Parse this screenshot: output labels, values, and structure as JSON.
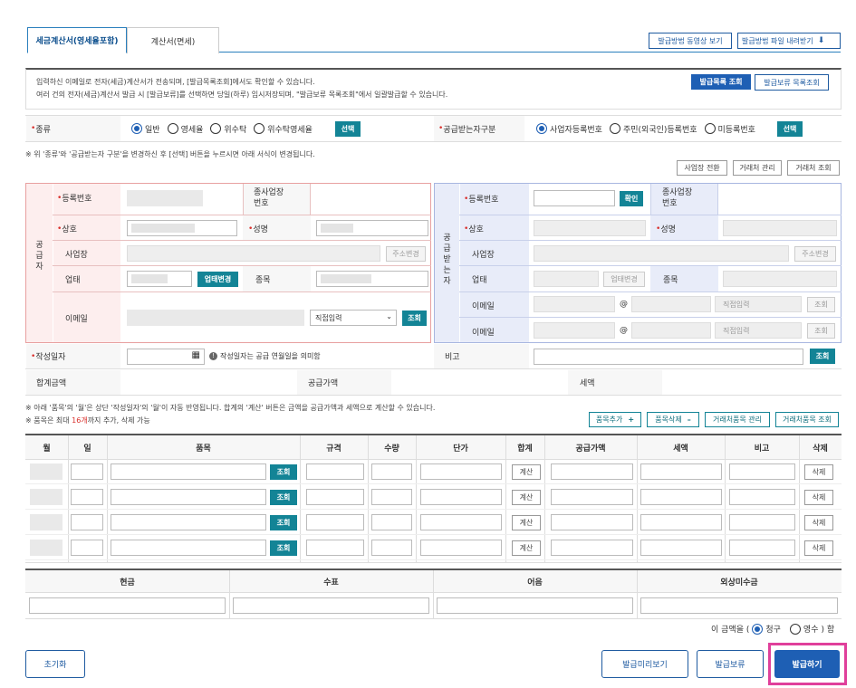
{
  "tabs": [
    {
      "label": "세금계산서(영세율포함)"
    },
    {
      "label": "계산서(면세)"
    }
  ],
  "top_buttons": {
    "video": "발급방법 동영상 보기",
    "file": "발급방법 파일 내려받기"
  },
  "notice": {
    "line1": "입력하신 이메일로 전자(세금)계산서가 전송되며, [발급목록조회]에서도 확인할 수 있습니다.",
    "line2": "여러 건의 전자(세금)계산서 발급 시 [발급보류]를 선택하면 당일(하루) 임시저장되며, \"발급보류 목록조회\"에서 일괄발급할 수 있습니다.",
    "btn_list": "발급목록 조회",
    "btn_hold": "발급보류 목록조회"
  },
  "type_row": {
    "label": "종류",
    "options": [
      "일반",
      "영세율",
      "위수탁",
      "위수탁영세율"
    ],
    "selected": "일반",
    "select_btn": "선택",
    "recv_label": "공급받는자구분",
    "recv_options": [
      "사업자등록번호",
      "주민(외국인)등록번호",
      "미등록번호"
    ],
    "recv_selected": "사업자등록번호",
    "recv_btn": "선택"
  },
  "form_note": "※ 위 '종류'와 '공급받는자 구분'을 변경하신 후 [선택] 버튼을 누르시면 아래 서식이 변경됩니다.",
  "mid_buttons": {
    "switch": "사업장 전환",
    "client_mgmt": "거래처 관리",
    "client_search": "거래처 조회"
  },
  "supplier": {
    "side": "공\n급\n자",
    "reg_no": "등록번호",
    "sub_no": "종사업장\n번호",
    "name": "상호",
    "ceo": "성명",
    "addr": "사업장",
    "addr_btn": "주소변경",
    "biz": "업태",
    "biz_btn": "업태변경",
    "item": "종목",
    "email": "이메일",
    "email_select": "직접입력",
    "email_btn": "조회"
  },
  "receiver": {
    "side": "공\n급\n받\n는\n자",
    "reg_no": "등록번호",
    "confirm_btn": "확인",
    "sub_no": "종사업장\n번호",
    "name": "상호",
    "ceo": "성명",
    "addr": "사업장",
    "addr_btn": "주소변경",
    "biz": "업태",
    "biz_btn": "업태변경",
    "item": "종목",
    "email1": "이메일",
    "email2": "이메일",
    "at": "@",
    "select": "직접입력",
    "btn": "조회"
  },
  "date_row": {
    "label": "작성일자",
    "hint": "작성일자는 공급 연월일을 의미함",
    "memo": "비고",
    "memo_btn": "조회"
  },
  "sum_row": {
    "total": "합계금액",
    "supply": "공급가액",
    "tax": "세액"
  },
  "items_note1": "※ 아래 '품목'의 '월'은 상단 '작성일자'의 '월'이 자동 반영됩니다. 합계의 '계산' 버튼은 금액을 공급가액과 세액으로 계산할 수 있습니다.",
  "items_note2_a": "※ 품목은 최대 ",
  "items_note2_b": "16개",
  "items_note2_c": "까지 추가, 삭제 가능",
  "item_buttons": {
    "add": "품목추가",
    "del": "품목삭제",
    "client_item_mgmt": "거래처품목 관리",
    "client_item_search": "거래처품목 조회"
  },
  "item_icons": {
    "add": "plus-icon",
    "del": "minus-icon"
  },
  "items_header": [
    "월",
    "일",
    "품목",
    "규격",
    "수량",
    "단가",
    "합계",
    "공급가액",
    "세액",
    "비고",
    "삭제"
  ],
  "item_rows": [
    {
      "search": "조회",
      "calc": "계산",
      "del": "삭제"
    },
    {
      "search": "조회",
      "calc": "계산",
      "del": "삭제"
    },
    {
      "search": "조회",
      "calc": "계산",
      "del": "삭제"
    },
    {
      "search": "조회",
      "calc": "계산",
      "del": "삭제"
    }
  ],
  "payment_header": [
    "현금",
    "수표",
    "어음",
    "외상미수금"
  ],
  "claim": {
    "prefix": "이 금액을 (",
    "opt1": "청구",
    "opt2": "영수",
    "suffix": ") 함",
    "selected": "청구"
  },
  "bottom": {
    "reset": "초기화",
    "preview": "발급미리보기",
    "hold": "발급보류",
    "issue": "발급하기"
  },
  "colors": {
    "primary": "#1e5fb4",
    "teal": "#138496",
    "highlight": "#e0409b"
  }
}
